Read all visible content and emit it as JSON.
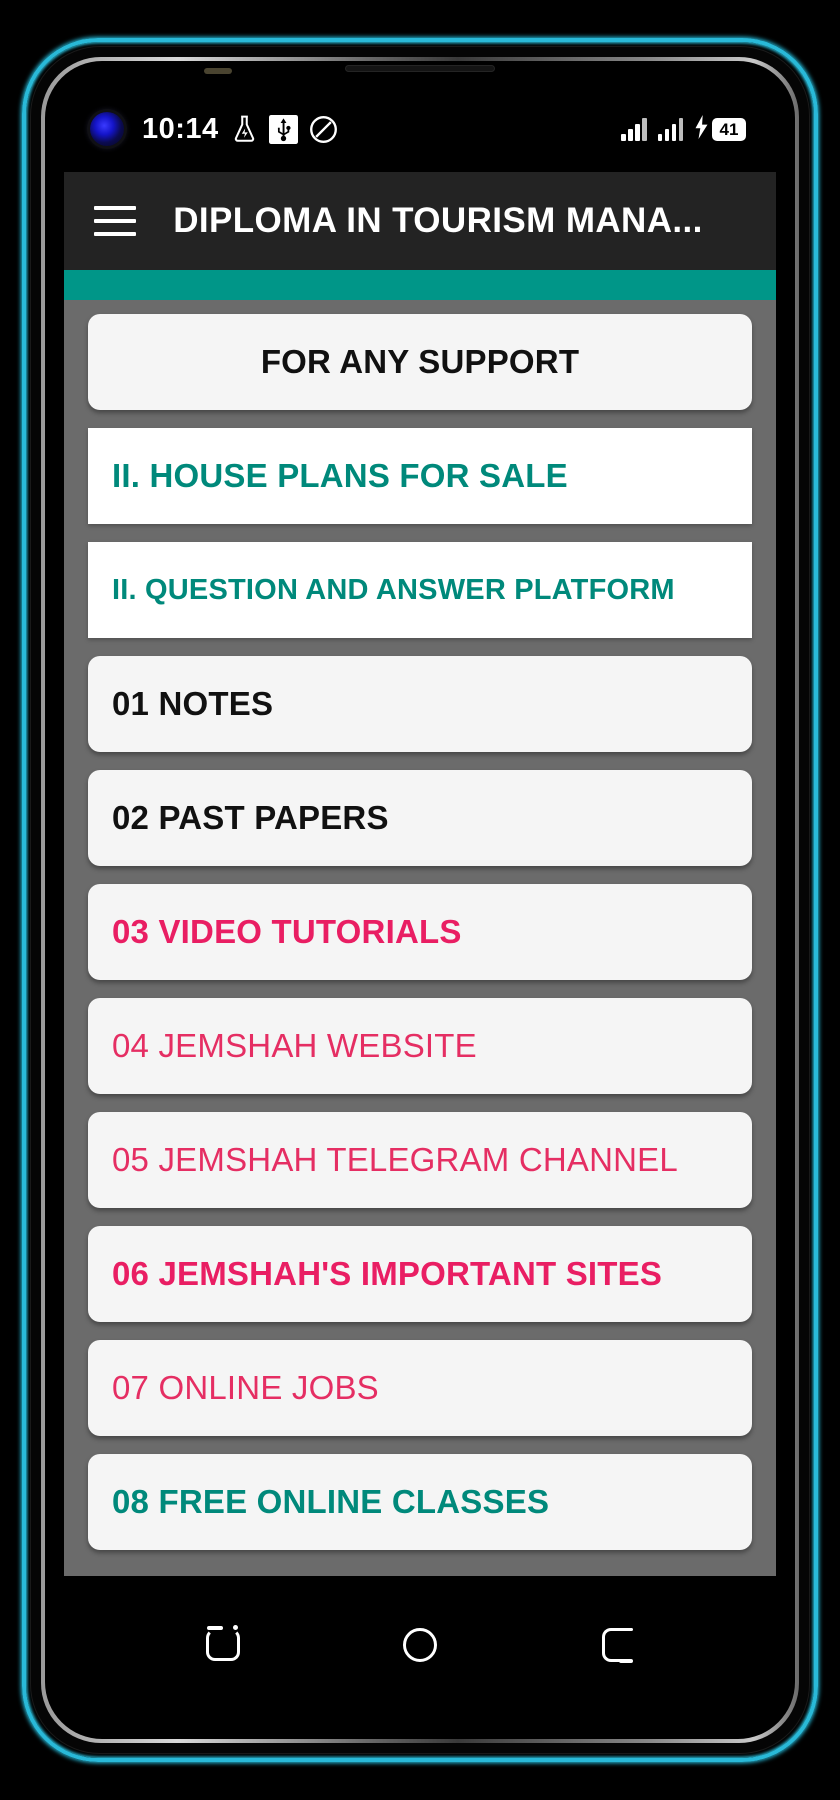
{
  "status_bar": {
    "clock": "10:14",
    "icons": [
      "flask-icon",
      "usb-icon",
      "do-not-disturb-icon"
    ],
    "signal_primary": "signal-bars-icon",
    "signal_secondary": "signal-bars-icon",
    "charging": "charging-bolt-icon",
    "battery_level": "41"
  },
  "app_bar": {
    "menu_icon": "hamburger-menu-icon",
    "title": "DIPLOMA IN TOURISM MANA..."
  },
  "theme": {
    "accent_teal": "#009688",
    "text_teal": "#00897b",
    "text_pink": "#e91e63",
    "app_bar_bg": "#232323",
    "content_bg": "#6b6b6b",
    "card_bg": "#f5f5f5",
    "bezel_glow": "#29b9d8"
  },
  "list": {
    "items": [
      {
        "label": "FOR ANY SUPPORT",
        "style": "center",
        "card": "raised"
      },
      {
        "label": "II. HOUSE PLANS FOR SALE",
        "style": "teal",
        "card": "flat"
      },
      {
        "label": "II. QUESTION AND ANSWER PLATFORM",
        "style": "teal sm",
        "card": "flat"
      },
      {
        "label": "01  NOTES",
        "style": "",
        "card": "raised"
      },
      {
        "label": "02 PAST PAPERS",
        "style": "",
        "card": "raised"
      },
      {
        "label": "03 VIDEO TUTORIALS",
        "style": "pink",
        "card": "raised"
      },
      {
        "label": "04 JEMSHAH WEBSITE",
        "style": "pink-soft",
        "card": "raised"
      },
      {
        "label": "05 JEMSHAH TELEGRAM CHANNEL",
        "style": "pink-soft",
        "card": "raised"
      },
      {
        "label": "06 JEMSHAH'S IMPORTANT SITES",
        "style": "pink",
        "card": "raised"
      },
      {
        "label": "07 ONLINE JOBS",
        "style": "pink-soft",
        "card": "raised"
      },
      {
        "label": "08 FREE ONLINE CLASSES",
        "style": "teal",
        "card": "raised"
      }
    ]
  },
  "nav_bar": {
    "recents": "recents-icon",
    "home": "home-circle-icon",
    "back": "back-icon"
  }
}
